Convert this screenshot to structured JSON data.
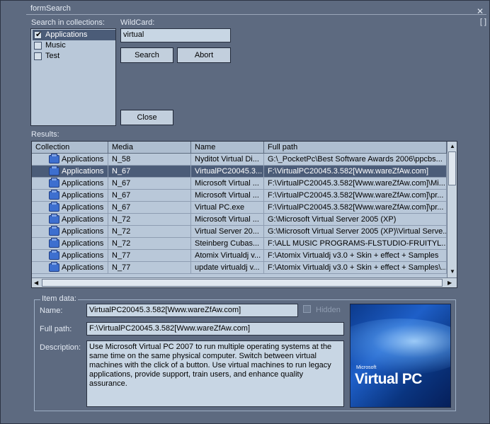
{
  "window": {
    "title": "formSearch",
    "close_symbol": "✕",
    "restore_symbol": "[ ]"
  },
  "search": {
    "collections_label": "Search in collections:",
    "collections": [
      {
        "label": "Applications",
        "checked": true
      },
      {
        "label": "Music",
        "checked": false
      },
      {
        "label": "Test",
        "checked": false
      }
    ],
    "wildcard_label": "WildCard:",
    "wildcard_value": "virtual",
    "search_button": "Search",
    "abort_button": "Abort",
    "close_button": "Close"
  },
  "results": {
    "label": "Results:",
    "columns": [
      "Collection",
      "Media",
      "Name",
      "Full path"
    ],
    "rows": [
      {
        "collection": "Applications",
        "media": "N_58",
        "name": "Nyditot Virtual Di...",
        "path": "G:\\_PocketPc\\Best Software Awards 2006\\ppcbs..."
      },
      {
        "collection": "Applications",
        "media": "N_67",
        "name": "VirtualPC20045.3...",
        "path": "F:\\VirtualPC20045.3.582[Www.wareZfAw.com]",
        "selected": true
      },
      {
        "collection": "Applications",
        "media": "N_67",
        "name": "Microsoft Virtual ...",
        "path": "F:\\VirtualPC20045.3.582[Www.wareZfAw.com]\\Mi..."
      },
      {
        "collection": "Applications",
        "media": "N_67",
        "name": "Microsoft Virtual ...",
        "path": "F:\\VirtualPC20045.3.582[Www.wareZfAw.com]\\pr..."
      },
      {
        "collection": "Applications",
        "media": "N_67",
        "name": "Virtual PC.exe",
        "path": "F:\\VirtualPC20045.3.582[Www.wareZfAw.com]\\pr..."
      },
      {
        "collection": "Applications",
        "media": "N_72",
        "name": "Microsoft Virtual ...",
        "path": "G:\\Microsoft Virtual Server 2005 (XP)"
      },
      {
        "collection": "Applications",
        "media": "N_72",
        "name": "Virtual Server 20...",
        "path": "G:\\Microsoft Virtual Server 2005 (XP)\\Virtual Serve..."
      },
      {
        "collection": "Applications",
        "media": "N_72",
        "name": "Steinberg Cubas...",
        "path": "F:\\ALL MUSIC PROGRAMS-FLSTUDIO-FRUITYL..."
      },
      {
        "collection": "Applications",
        "media": "N_77",
        "name": "Atomix Virtualdj v...",
        "path": "F:\\Atomix Virtualdj v3.0 + Skin + effect + Samples"
      },
      {
        "collection": "Applications",
        "media": "N_77",
        "name": "update virtualdj v...",
        "path": "F:\\Atomix Virtualdj v3.0 + Skin + effect + Samples\\..."
      }
    ]
  },
  "item_data": {
    "group_label": "Item data:",
    "name_label": "Name:",
    "name_value": "VirtualPC20045.3.582[Www.wareZfAw.com]",
    "hidden_label": "Hidden",
    "fullpath_label": "Full path:",
    "fullpath_value": "F:\\VirtualPC20045.3.582[Www.wareZfAw.com]",
    "description_label": "Description:",
    "description_value": "Use Microsoft Virtual PC 2007 to run multiple operating systems at the same time on the same physical computer. Switch between virtual machines with the click of a button. Use virtual machines to run legacy applications, provide support, train users, and enhance quality assurance.",
    "preview_small": "Microsoft",
    "preview_title": "Virtual PC"
  }
}
